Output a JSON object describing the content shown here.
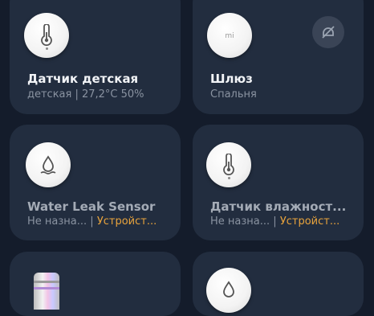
{
  "devices": [
    {
      "title": "Датчик детская",
      "subtitle": "детская | 27,2°C 50%",
      "icon": "thermometer-icon"
    },
    {
      "title": "Шлюз",
      "subtitle": "Спальня",
      "icon": "gateway-icon",
      "badge_icon": "offline-icon"
    },
    {
      "title": "Water Leak Sensor",
      "subtitle_unassigned": "Не назна...",
      "subtitle_sep": " | ",
      "subtitle_status": "Устройст...",
      "icon": "water-drop-icon"
    },
    {
      "title": "Датчик влажност...",
      "subtitle_unassigned": "Не назна...",
      "subtitle_sep": " | ",
      "subtitle_status": "Устройст...",
      "icon": "thermometer-icon"
    },
    {
      "icon": "light-bulb-icon"
    },
    {
      "icon": "water-drop-icon"
    }
  ],
  "colors": {
    "background": "#141c2b",
    "card": "#222d3f",
    "title": "#f2f4f7",
    "subtitle": "#8a93a1",
    "warning": "#e8a33c"
  }
}
